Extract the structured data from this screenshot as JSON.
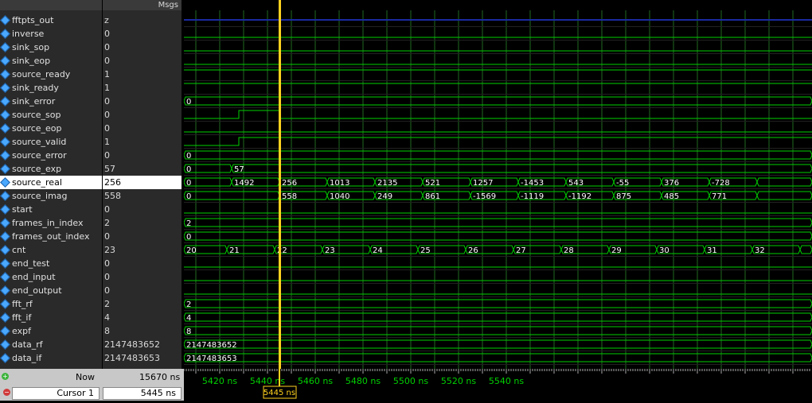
{
  "header": {
    "msgs_label": "Msgs"
  },
  "signals": [
    {
      "name": "fftpts_out",
      "value": "z"
    },
    {
      "name": "inverse",
      "value": "0"
    },
    {
      "name": "sink_sop",
      "value": "0"
    },
    {
      "name": "sink_eop",
      "value": "0"
    },
    {
      "name": "source_ready",
      "value": "1"
    },
    {
      "name": "sink_ready",
      "value": "1"
    },
    {
      "name": "sink_error",
      "value": "0"
    },
    {
      "name": "source_sop",
      "value": "0"
    },
    {
      "name": "source_eop",
      "value": "0"
    },
    {
      "name": "source_valid",
      "value": "1"
    },
    {
      "name": "source_error",
      "value": "0"
    },
    {
      "name": "source_exp",
      "value": "57"
    },
    {
      "name": "source_real",
      "value": "256"
    },
    {
      "name": "source_imag",
      "value": "558"
    },
    {
      "name": "start",
      "value": "0"
    },
    {
      "name": "frames_in_index",
      "value": "2"
    },
    {
      "name": "frames_out_index",
      "value": "0"
    },
    {
      "name": "cnt",
      "value": "23"
    },
    {
      "name": "end_test",
      "value": "0"
    },
    {
      "name": "end_input",
      "value": "0"
    },
    {
      "name": "end_output",
      "value": "0"
    },
    {
      "name": "fft_rf",
      "value": "2"
    },
    {
      "name": "fft_if",
      "value": "4"
    },
    {
      "name": "expf",
      "value": "8"
    },
    {
      "name": "data_rf",
      "value": "2147483652"
    },
    {
      "name": "data_if",
      "value": "2147483653"
    }
  ],
  "selected_signal": "source_real",
  "waveforms": {
    "sink_error": {
      "type": "bus",
      "segments": [
        {
          "t": 5405,
          "label": "0"
        }
      ]
    },
    "source_sop": {
      "type": "bit",
      "transitions": [
        {
          "t": 5405,
          "v": 0
        },
        {
          "t": 5428,
          "v": 1
        },
        {
          "t": 5445,
          "v": 0
        }
      ]
    },
    "source_valid": {
      "type": "bit",
      "transitions": [
        {
          "t": 5405,
          "v": 0
        },
        {
          "t": 5428,
          "v": 1
        }
      ]
    },
    "source_error": {
      "type": "bus",
      "segments": [
        {
          "t": 5405,
          "label": "0"
        }
      ]
    },
    "source_exp": {
      "type": "bus",
      "segments": [
        {
          "t": 5405,
          "label": "0"
        },
        {
          "t": 5425,
          "label": "57"
        }
      ]
    },
    "source_real": {
      "type": "bus",
      "segments": [
        {
          "t": 5405,
          "label": "0"
        },
        {
          "t": 5425,
          "label": "1492"
        },
        {
          "t": 5445,
          "label": "256"
        },
        {
          "t": 5465,
          "label": "1013"
        },
        {
          "t": 5485,
          "label": "2135"
        },
        {
          "t": 5505,
          "label": "521"
        },
        {
          "t": 5525,
          "label": "1257"
        },
        {
          "t": 5545,
          "label": "-1453"
        },
        {
          "t": 5565,
          "label": "543"
        },
        {
          "t": 5585,
          "label": "-55"
        },
        {
          "t": 5605,
          "label": "376"
        },
        {
          "t": 5625,
          "label": "-728"
        },
        {
          "t": 5645,
          "label": ""
        }
      ]
    },
    "source_imag": {
      "type": "bus",
      "segments": [
        {
          "t": 5405,
          "label": "0"
        },
        {
          "t": 5445,
          "label": "558"
        },
        {
          "t": 5465,
          "label": "1040"
        },
        {
          "t": 5485,
          "label": "249"
        },
        {
          "t": 5505,
          "label": "861"
        },
        {
          "t": 5525,
          "label": "-1569"
        },
        {
          "t": 5545,
          "label": "-1119"
        },
        {
          "t": 5565,
          "label": "-1192"
        },
        {
          "t": 5585,
          "label": "875"
        },
        {
          "t": 5605,
          "label": "485"
        },
        {
          "t": 5625,
          "label": "771"
        },
        {
          "t": 5645,
          "label": ""
        }
      ]
    },
    "frames_in_index": {
      "type": "bus",
      "segments": [
        {
          "t": 5405,
          "label": "2"
        }
      ]
    },
    "frames_out_index": {
      "type": "bus",
      "segments": [
        {
          "t": 5405,
          "label": "0"
        }
      ]
    },
    "cnt": {
      "type": "bus",
      "segments": [
        {
          "t": 5405,
          "label": "20"
        },
        {
          "t": 5423,
          "label": "21"
        },
        {
          "t": 5443,
          "label": "22"
        },
        {
          "t": 5463,
          "label": "23"
        },
        {
          "t": 5483,
          "label": "24"
        },
        {
          "t": 5503,
          "label": "25"
        },
        {
          "t": 5523,
          "label": "26"
        },
        {
          "t": 5543,
          "label": "27"
        },
        {
          "t": 5563,
          "label": "28"
        },
        {
          "t": 5583,
          "label": "29"
        },
        {
          "t": 5603,
          "label": "30"
        },
        {
          "t": 5623,
          "label": "31"
        },
        {
          "t": 5643,
          "label": "32"
        },
        {
          "t": 5663,
          "label": ""
        }
      ]
    },
    "fft_rf": {
      "type": "bus",
      "segments": [
        {
          "t": 5405,
          "label": "2"
        }
      ]
    },
    "fft_if": {
      "type": "bus",
      "segments": [
        {
          "t": 5405,
          "label": "4"
        }
      ]
    },
    "expf": {
      "type": "bus",
      "segments": [
        {
          "t": 5405,
          "label": "8"
        }
      ]
    },
    "data_rf": {
      "type": "bus",
      "segments": [
        {
          "t": 5405,
          "label": "2147483652"
        }
      ]
    },
    "data_if": {
      "type": "bus",
      "segments": [
        {
          "t": 5405,
          "label": "2147483653"
        }
      ]
    }
  },
  "timeline": {
    "labels": [
      {
        "t": 5420,
        "label": "5420 ns"
      },
      {
        "t": 5440,
        "label": "5440 ns"
      },
      {
        "t": 5460,
        "label": "5460 ns"
      },
      {
        "t": 5480,
        "label": "5480 ns"
      },
      {
        "t": 5500,
        "label": "5500 ns"
      },
      {
        "t": 5520,
        "label": "5520 ns"
      },
      {
        "t": 5540,
        "label": "5540 ns"
      }
    ],
    "cursor_t": 5445
  },
  "footer": {
    "now_label": "Now",
    "now_value": "15670 ns",
    "cursor_label": "Cursor 1",
    "cursor_value": "5445 ns",
    "cursor_flag": "5445 ns"
  },
  "colors": {
    "wave": "#00d000",
    "cursor": "#ffd21e",
    "grid": "#1f6a1f",
    "text": "#ffffff",
    "z": "#1a2aa0"
  }
}
